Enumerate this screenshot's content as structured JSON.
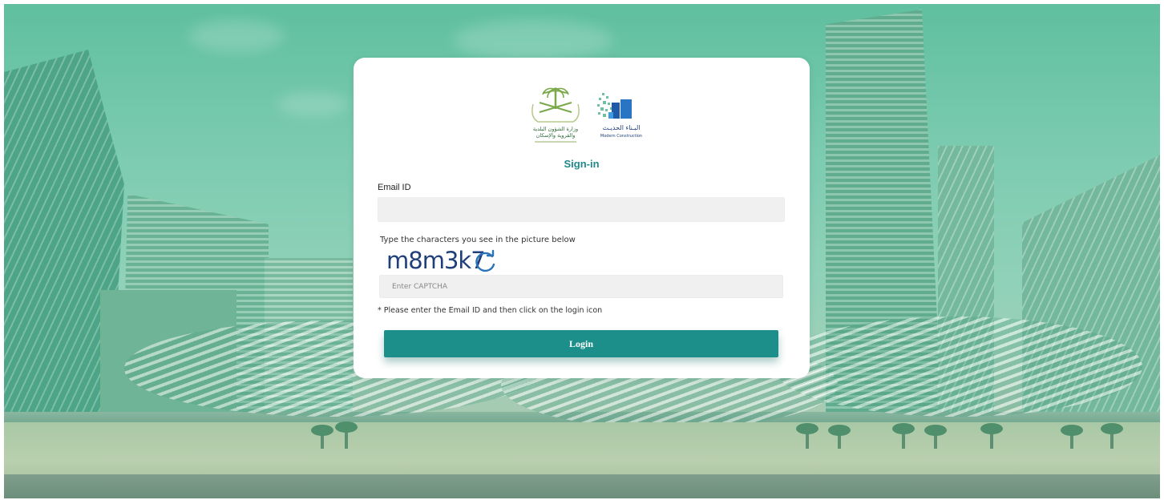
{
  "login": {
    "title": "Sign-in",
    "email_label": "Email ID",
    "email_value": "",
    "email_placeholder": "",
    "captcha_instruction": "Type the characters you see in the picture below",
    "captcha_code": "m8m3k7",
    "captcha_placeholder": "Enter CAPTCHA",
    "note": "* Please enter the Email ID and then click on the login icon",
    "login_label": "Login"
  },
  "logos": {
    "ministry_ar_line1": "وزارة الشؤون البلدية",
    "ministry_ar_line2": "والقروية والإسكان",
    "modern_ar": "البـناء الحديـث",
    "modern_en": "Modern Construction"
  },
  "icons": {
    "refresh": "refresh-icon",
    "ministry_logo": "palm-swords-emblem"
  },
  "colors": {
    "accent": "#1c8f8b",
    "title": "#20888a",
    "captcha": "#1f3f7a",
    "background_tint": "#6fc3a4"
  }
}
